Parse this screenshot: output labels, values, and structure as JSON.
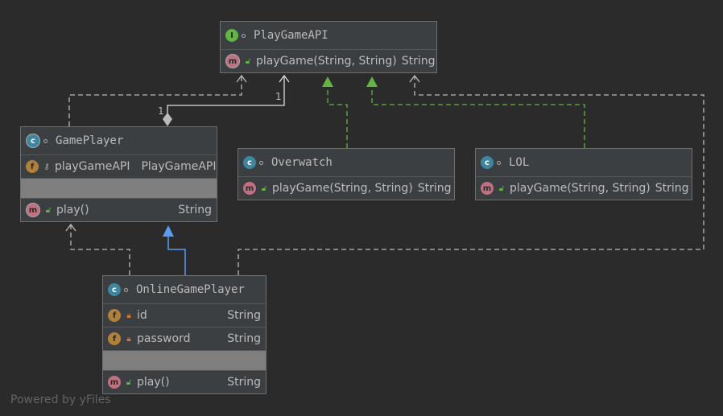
{
  "footer": "Powered by yFiles",
  "nodes": {
    "playgameapi": {
      "title": "PlayGameAPI",
      "methods": [
        {
          "name": "playGame(String, String)",
          "type": "String"
        }
      ]
    },
    "gameplayer": {
      "title": "GamePlayer",
      "fields": [
        {
          "name": "playGameAPI",
          "type": "PlayGameAPI"
        }
      ],
      "methods": [
        {
          "name": "play()",
          "type": "String"
        }
      ]
    },
    "overwatch": {
      "title": "Overwatch",
      "methods": [
        {
          "name": "playGame(String, String)",
          "type": "String"
        }
      ]
    },
    "lol": {
      "title": "LOL",
      "methods": [
        {
          "name": "playGame(String, String)",
          "type": "String"
        }
      ]
    },
    "onlinegameplayer": {
      "title": "OnlineGamePlayer",
      "fields": [
        {
          "name": "id",
          "type": "String"
        },
        {
          "name": "password",
          "type": "String"
        }
      ],
      "methods": [
        {
          "name": "play()",
          "type": "String"
        }
      ]
    }
  },
  "edges": {
    "aggregation_mult_source": "1",
    "aggregation_mult_target": "1"
  },
  "icons": {
    "interface": "I",
    "class": "c",
    "field": "f",
    "method": "m"
  },
  "colors": {
    "background": "#2b2b2b",
    "node": "#3c3f41",
    "dependency": "#bbbbbb",
    "realization": "#62b543",
    "generalization": "#589df6"
  }
}
